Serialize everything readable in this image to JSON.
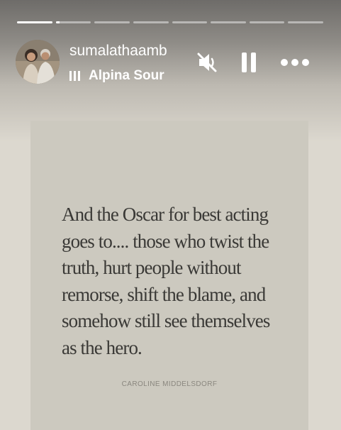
{
  "story": {
    "segments": [
      {
        "progress": 1.0
      },
      {
        "progress": 0.1
      },
      {
        "progress": 0
      },
      {
        "progress": 0
      },
      {
        "progress": 0
      },
      {
        "progress": 0
      },
      {
        "progress": 0
      },
      {
        "progress": 0
      }
    ],
    "username": "sumalathaamb",
    "audio": {
      "name": "Alpina Sour"
    },
    "icons": {
      "mute": "speaker-muted-icon",
      "pause": "pause-icon",
      "more": "more-dots-icon",
      "audio": "audio-bars-icon"
    }
  },
  "post": {
    "quote": "And the Oscar for best acting goes to.... those who twist the truth, hurt people without remorse, shift the blame, and somehow still see themselves as the hero.",
    "author": "CAROLINE MIDDELSDORF"
  },
  "colors": {
    "background": "#dcd8cf",
    "card": "#ccc9bf",
    "quote_text": "#3a3936",
    "author_text": "#8a877f"
  }
}
